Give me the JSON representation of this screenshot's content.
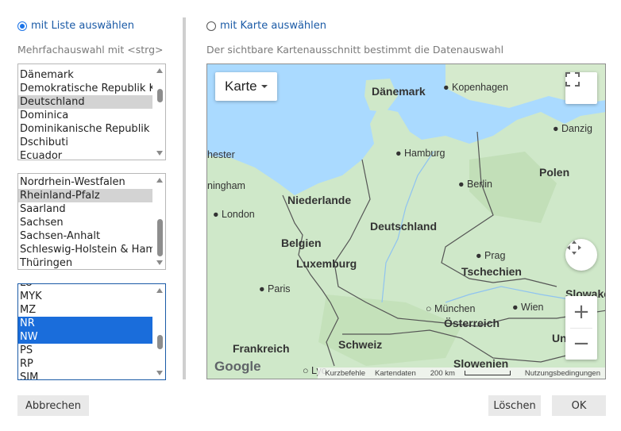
{
  "left_panel": {
    "radio_label": "mit Liste auswählen",
    "hint": "Mehrfachauswahl mit <strg>",
    "countries": [
      "Dänemark",
      "Demokratische Republik Kongo",
      "Deutschland",
      "Dominica",
      "Dominikanische Republik",
      "Dschibuti",
      "Ecuador"
    ],
    "states": [
      "Nordrhein-Westfalen",
      "Rheinland-Pfalz",
      "Saarland",
      "Sachsen",
      "Sachsen-Anhalt",
      "Schleswig-Holstein & Hamburg",
      "Thüringen"
    ],
    "codes": [
      "LU",
      "MYK",
      "MZ",
      "NR",
      "NW",
      "PS",
      "RP",
      "SIM"
    ]
  },
  "right_panel": {
    "radio_label": "mit Karte auswählen",
    "hint": "Der sichtbare Kartenausschnitt bestimmt die Datenauswahl"
  },
  "map": {
    "map_type": "Karte",
    "logo": "Google",
    "labels": {
      "daenemark": "Dänemark",
      "kopenhagen": "Kopenhagen",
      "danzig": "Danzig",
      "chester": "hester",
      "hamburg": "Hamburg",
      "polen": "Polen",
      "birmingham": "ningham",
      "berlin": "Berlin",
      "niederlande": "Niederlande",
      "london": "London",
      "deutschland": "Deutschland",
      "belgien": "Belgien",
      "prag": "Prag",
      "luxemburg": "Luxemburg",
      "tschechien": "Tschechien",
      "paris": "Paris",
      "slowakei": "Slowakei",
      "muenchen": "München",
      "wien": "Wien",
      "oesterreich": "Österreich",
      "frankreich": "Frankreich",
      "schweiz": "Schweiz",
      "slowenien": "Slowenien",
      "lyon": "Lyc",
      "ungarn": "Un"
    },
    "attribution": {
      "shortcuts": "Kurzbefehle",
      "map_data": "Kartendaten",
      "scale": "200 km",
      "terms": "Nutzungsbedingungen"
    },
    "zoom_in": "+",
    "zoom_out": "−",
    "icons": [
      "fullscreen-icon",
      "camera-control-icon"
    ]
  },
  "footer": {
    "cancel": "Abbrechen",
    "clear": "Löschen",
    "ok": "OK"
  },
  "colors": {
    "accent": "#1a73e8",
    "link_text": "#1a5aa6",
    "selection_blue": "#1a6ddb",
    "selection_gray": "#d3d3d3",
    "water": "#aadaff",
    "land": "#cfe8c9"
  }
}
